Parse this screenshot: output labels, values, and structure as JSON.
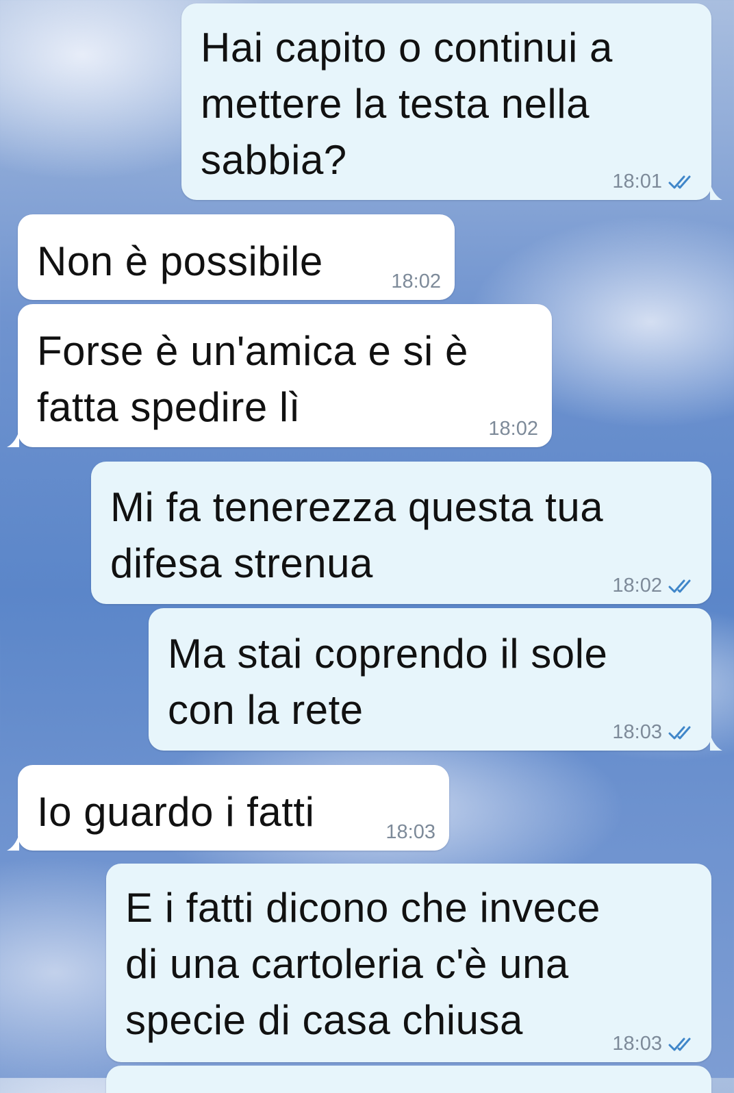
{
  "messages": [
    {
      "direction": "out",
      "text": "Hai capito o continui a\nmettere la testa nella\nsabbia?",
      "time": "18:01",
      "status": "read"
    },
    {
      "direction": "in",
      "text": "Non è possibile",
      "time": "18:02"
    },
    {
      "direction": "in",
      "text": "Forse è un'amica e si è\nfatta spedire lì",
      "time": "18:02"
    },
    {
      "direction": "out",
      "text": "Mi fa tenerezza questa tua\ndifesa strenua",
      "time": "18:02",
      "status": "read"
    },
    {
      "direction": "out",
      "text": "Ma stai coprendo il sole\ncon la rete",
      "time": "18:03",
      "status": "read"
    },
    {
      "direction": "in",
      "text": "Io guardo i fatti",
      "time": "18:03"
    },
    {
      "direction": "out",
      "text": "E i fatti dicono che invece\ndi una cartoleria c'è una\nspecie di casa chiusa",
      "time": "18:03",
      "status": "read"
    }
  ],
  "colors": {
    "outgoing_bubble": "#e7f5fb",
    "incoming_bubble": "#ffffff",
    "time_text": "#7d8a99",
    "read_check": "#3f86c9"
  },
  "icons": {
    "read_status": "double-check-icon"
  }
}
